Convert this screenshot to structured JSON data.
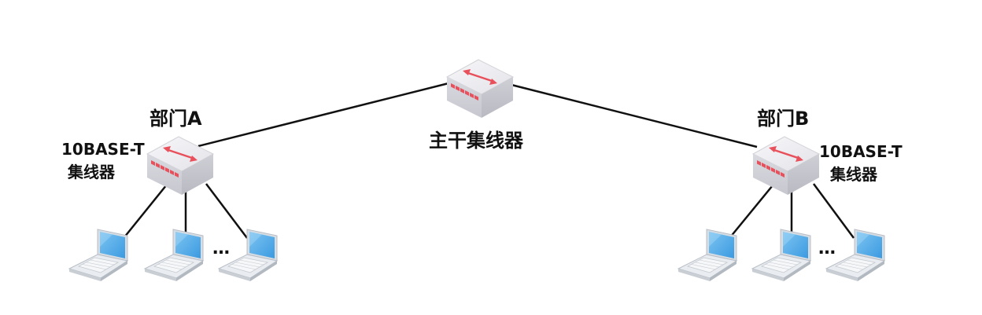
{
  "labels": {
    "backbone_hub": "主干集线器",
    "dept_a": "部门A",
    "dept_b": "部门B",
    "hub_a_line1": "10BASE-T",
    "hub_a_line2": "集线器",
    "hub_b_line1": "10BASE-T",
    "hub_b_line2": "集线器",
    "ellipsis_a": "…",
    "ellipsis_b": "…"
  },
  "icons": {
    "hub": "network-hub-icon",
    "computer": "laptop-icon"
  },
  "colors": {
    "hub_body": "#e6e6ec",
    "hub_accent": "#e8505b",
    "laptop_screen": "#4aa8e8",
    "link": "#111111"
  }
}
